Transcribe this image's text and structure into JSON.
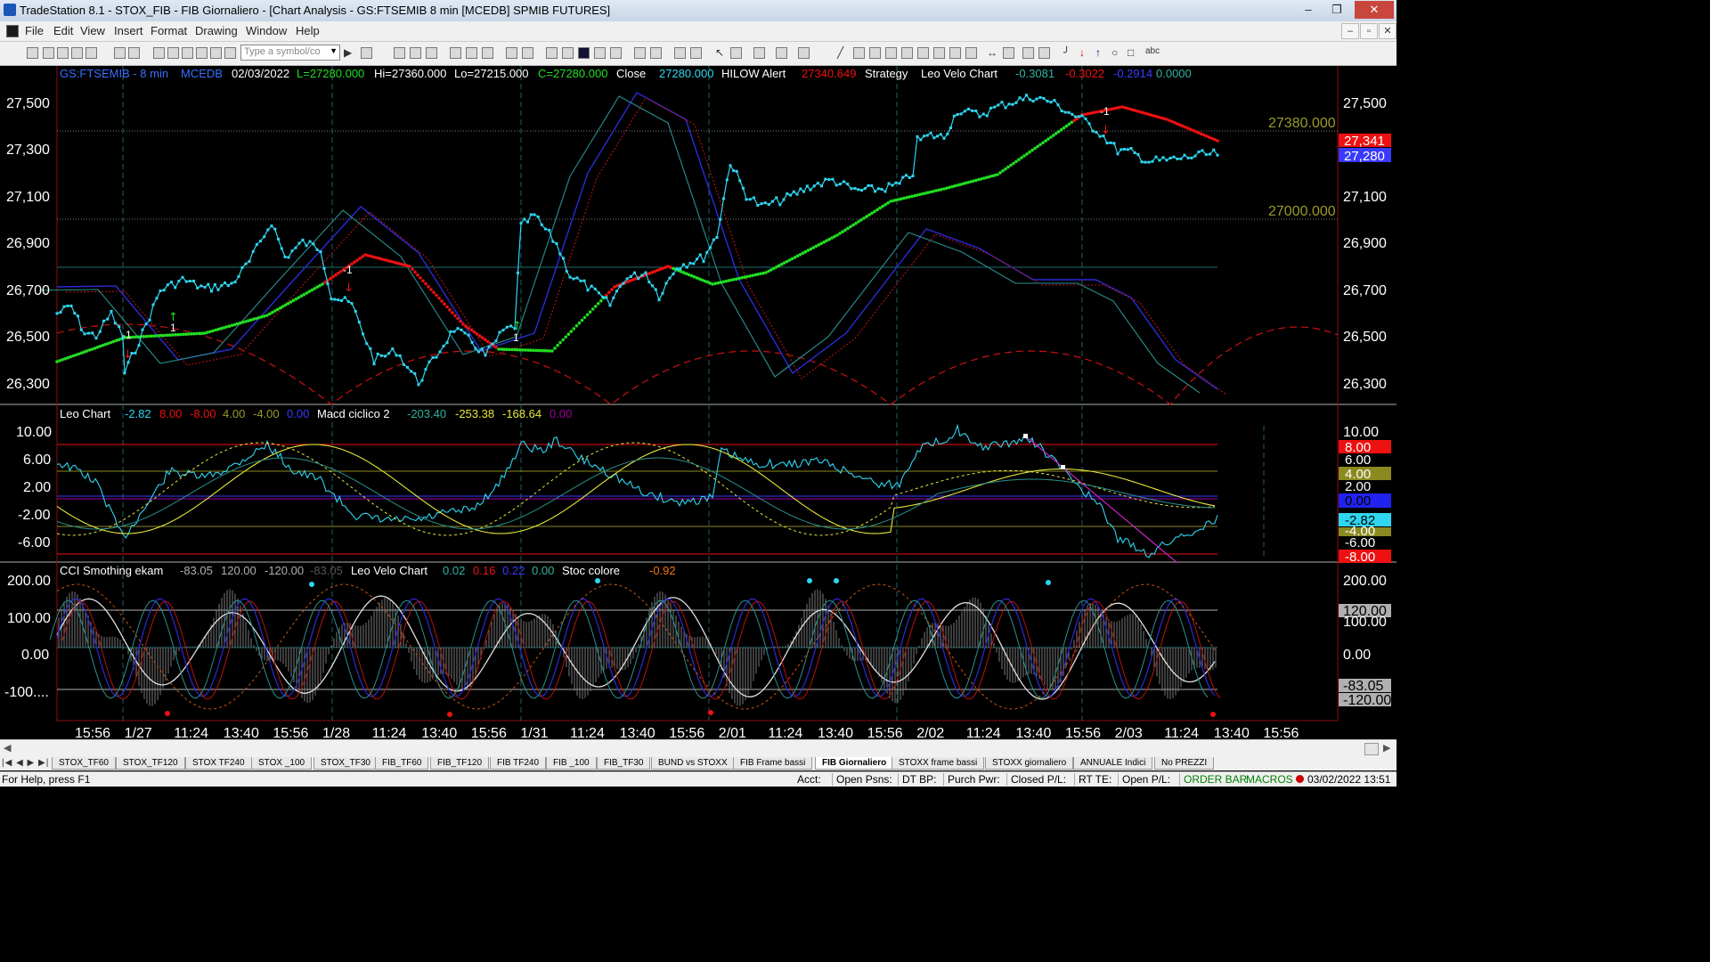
{
  "window": {
    "title": "TradeStation 8.1 - STOX_FIB - FIB Giornaliero - [Chart Analysis - GS:FTSEMIB  8 min  [MCEDB] SPMIB FUTURES]",
    "buttons": [
      "–",
      "❐",
      "✕"
    ]
  },
  "menu": {
    "items": [
      "File",
      "Edit",
      "View",
      "Insert",
      "Format",
      "Drawing",
      "Window",
      "Help"
    ],
    "mdi_buttons": [
      "–",
      "▫",
      "✕"
    ]
  },
  "toolbar": {
    "symbol_placeholder": "Type a symbol/co",
    "text_tool": "abc"
  },
  "chart": {
    "header": {
      "symbol": "GS:FTSEMIB - 8 min",
      "feed": "MCEDB",
      "date": "02/03/2022",
      "last": "L=27280.000",
      "high": "Hi=27360.000",
      "low": "Lo=27215.000",
      "close_eq": "C=27280.000",
      "close_label": "Close",
      "close_value": "27280.000",
      "hilow_label": "HILOW Alert",
      "hilow_value": "27340.649",
      "strategy_label": "Strategy",
      "velo_label": "Leo Velo Chart",
      "velo_v1": "-0.3081",
      "velo_v2": "-0.3022",
      "velo_v3": "-0.2914",
      "velo_v4": "0.0000"
    },
    "price_axis": [
      "27,500",
      "27,300",
      "27,100",
      "26,900",
      "26,700",
      "26,500",
      "26,300"
    ],
    "price_levels": {
      "upper": "27380.000",
      "lower": "27000.000"
    },
    "price_badges": {
      "hilow": "27,341",
      "last": "27,280"
    },
    "trade_marker": "-1",
    "long_marker": "1",
    "leo_chart": {
      "label": "Leo Chart",
      "values": [
        "-2.82",
        "8.00",
        "-8.00",
        "4.00",
        "-4.00",
        "0.00"
      ],
      "macd_label": "Macd ciclico 2",
      "macd_values": [
        "-203.40",
        "-253.38",
        "-168.64",
        "0.00"
      ],
      "axis": [
        "10.00",
        "6.00",
        "2.00",
        "-2.00",
        "-6.00"
      ],
      "badges": [
        "8.00",
        "6.00",
        "4.00",
        "2.00",
        "0.00",
        "-2.82",
        "-4.00",
        "-6.00",
        "-8.00"
      ]
    },
    "cci_panel": {
      "label": "CCI Smothing ekam",
      "values": [
        "-83.05",
        "120.00",
        "-120.00",
        "-83.05"
      ],
      "velo_label": "Leo Velo Chart",
      "velo_values": [
        "0.02",
        "0.16",
        "0.22",
        "0.00"
      ],
      "stoc_label": "Stoc colore",
      "stoc_value": "-0.92",
      "axis": [
        "200.00",
        "100.00",
        "0.00",
        "-100...."
      ],
      "badges": [
        "200.00",
        "120.00",
        "100.00",
        "0.00",
        "-83.05",
        "-120.00"
      ]
    },
    "time_axis": [
      "15:56",
      "1/27",
      "11:24",
      "13:40",
      "15:56",
      "1/28",
      "11:24",
      "13:40",
      "15:56",
      "1/31",
      "11:24",
      "13:40",
      "15:56",
      "2/01",
      "11:24",
      "13:40",
      "15:56",
      "2/02",
      "11:24",
      "13:40",
      "15:56",
      "2/03",
      "11:24",
      "13:40",
      "15:56"
    ],
    "colors": {
      "price": "#2fd6f0",
      "up": "#22dd22",
      "down": "#ee1111",
      "grid": "#1f6b6b",
      "level_text": "#9a9a2c",
      "axis_text": "#ffffff"
    }
  },
  "workspace_tabs": [
    "STOX_TF60",
    "STOX_TF120",
    "STOX TF240",
    "STOX _100",
    "STOX_TF30",
    "FIB_TF60",
    "FIB_TF120",
    "FIB TF240",
    "FIB _100",
    "FIB_TF30",
    "BUND vs STOXX",
    "FIB Frame bassi",
    "FIB Giornaliero",
    "STOXX frame bassi",
    "STOXX giornaliero",
    "ANNUALE Indici",
    "No PREZZI"
  ],
  "active_tab": "FIB Giornaliero",
  "status": {
    "help": "For Help, press F1",
    "acct": "Acct:",
    "open_psns": "Open Psns:",
    "dt_bp": "DT BP:",
    "purch_pwr": "Purch Pwr:",
    "closed_pl": "Closed P/L:",
    "rt_te": "RT TE:",
    "open_pl": "Open P/L:",
    "order_bar": "ORDER BAR",
    "macros": "MACROS",
    "datetime": "03/02/2022 13:51"
  }
}
